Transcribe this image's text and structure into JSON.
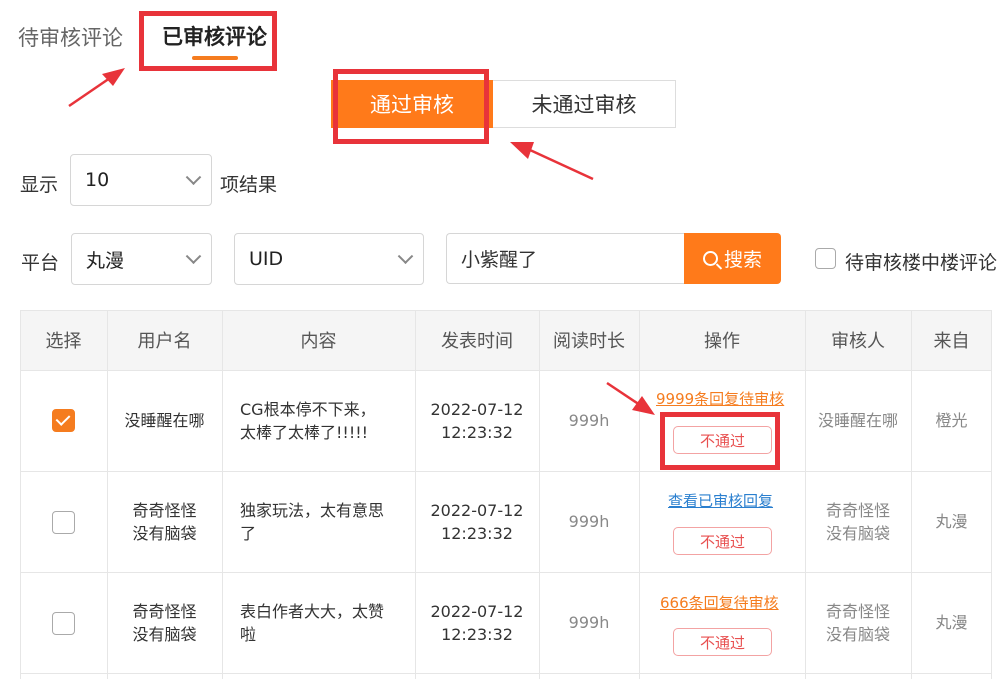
{
  "tabs": {
    "pending": "待审核评论",
    "reviewed": "已审核评论"
  },
  "segment": {
    "pass": "通过审核",
    "fail": "未通过审核"
  },
  "show": {
    "label": "显示",
    "value": "10",
    "suffix": "项结果"
  },
  "filter": {
    "platform_label": "平台",
    "platform_value": "丸漫",
    "field_value": "UID",
    "search_value": "小紫醒了",
    "search_button": "搜索",
    "checkbox_label": "待审核楼中楼评论"
  },
  "table": {
    "headers": [
      "选择",
      "用户名",
      "内容",
      "发表时间",
      "阅读时长",
      "操作",
      "审核人",
      "来自"
    ],
    "rows": [
      {
        "checked": true,
        "user_l1": "没睡醒在哪",
        "user_l2": "",
        "content_l1": "CG根本停不下来，",
        "content_l2": "太棒了太棒了!!!!!",
        "date": "2022-07-12",
        "time": "12:23:32",
        "duration": "999h",
        "action_link": "9999条回复待审核",
        "action_link_color": "#f57c1f",
        "reject": "不通过",
        "reviewer_l1": "没睡醒在哪",
        "reviewer_l2": "",
        "source": "橙光"
      },
      {
        "checked": false,
        "user_l1": "奇奇怪怪",
        "user_l2": "没有脑袋",
        "content_l1": "独家玩法，太有意思",
        "content_l2": "了",
        "date": "2022-07-12",
        "time": "12:23:32",
        "duration": "999h",
        "action_link": "查看已审核回复",
        "action_link_color": "#2a7fcf",
        "reject": "不通过",
        "reviewer_l1": "奇奇怪怪",
        "reviewer_l2": "没有脑袋",
        "source": "丸漫"
      },
      {
        "checked": false,
        "user_l1": "奇奇怪怪",
        "user_l2": "没有脑袋",
        "content_l1": "表白作者大大，太赞",
        "content_l2": "啦",
        "date": "2022-07-12",
        "time": "12:23:32",
        "duration": "999h",
        "action_link": "666条回复待审核",
        "action_link_color": "#f57c1f",
        "reject": "不通过",
        "reviewer_l1": "奇奇怪怪",
        "reviewer_l2": "没有脑袋",
        "source": "丸漫"
      }
    ]
  },
  "colors": {
    "accent": "#ff7a1a",
    "annotation": "#e8333a",
    "reject": "#e85050",
    "link_blue": "#2a7fcf"
  }
}
